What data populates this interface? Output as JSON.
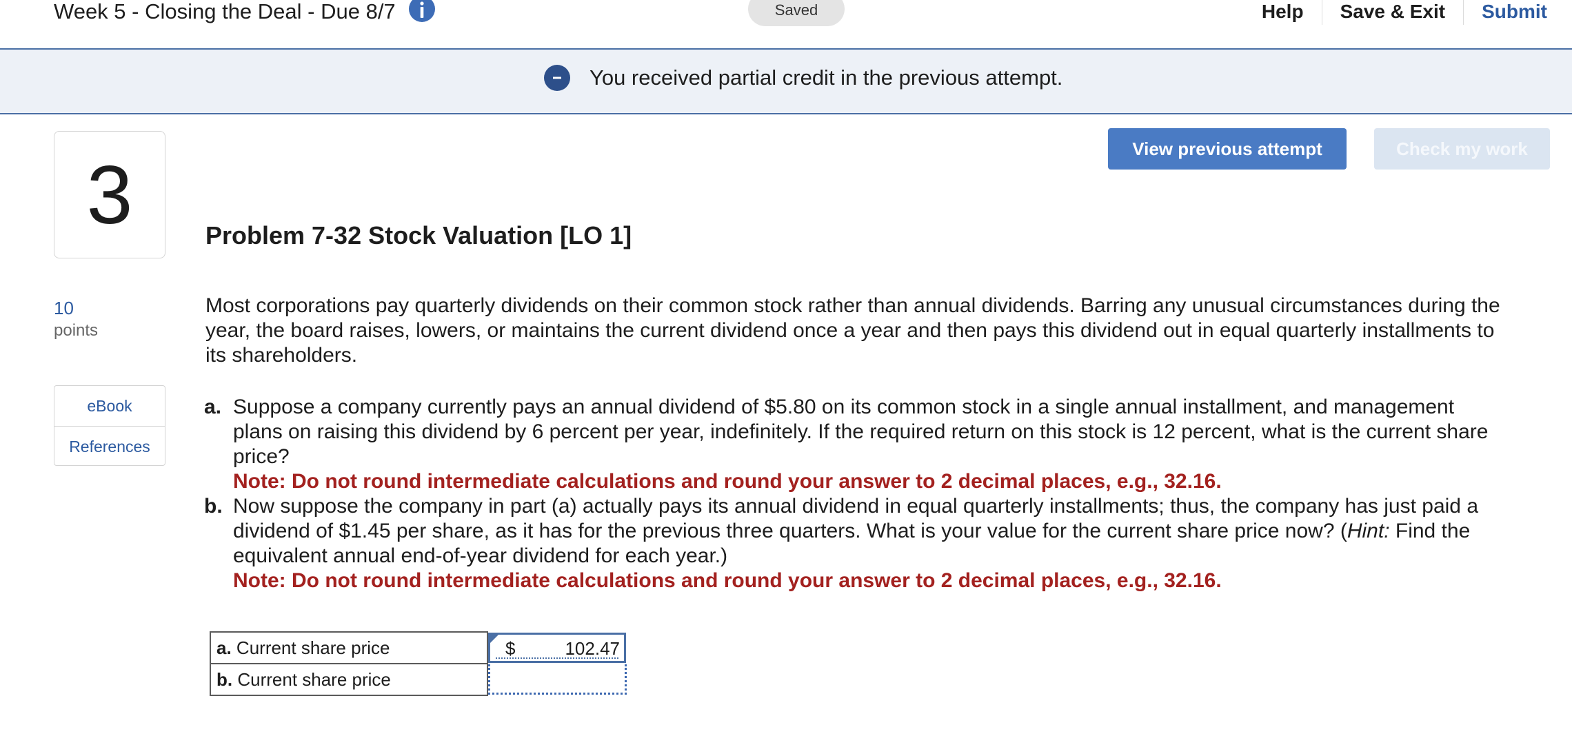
{
  "header": {
    "assignment_title": "Week 5 - Closing the Deal - Due 8/7",
    "saved_status": "Saved",
    "nav": {
      "help": "Help",
      "save_exit": "Save & Exit",
      "submit": "Submit"
    }
  },
  "banner": {
    "message": "You received partial credit in the previous attempt."
  },
  "question": {
    "number": "3",
    "points_value": "10",
    "points_label": "points",
    "resources": {
      "ebook": "eBook",
      "references": "References"
    }
  },
  "buttons": {
    "view_previous": "View previous attempt",
    "check_work": "Check my work"
  },
  "problem": {
    "title": "Problem 7-32 Stock Valuation [LO 1]",
    "intro": "Most corporations pay quarterly dividends on their common stock rather than annual dividends. Barring any unusual circumstances during the year, the board raises, lowers, or maintains the current dividend once a year and then pays this dividend out in equal quarterly installments to its shareholders.",
    "parts": [
      {
        "letter": "a.",
        "text": "Suppose a company currently pays an annual dividend of $5.80 on its common stock in a single annual installment, and management plans on raising this dividend by 6 percent per year, indefinitely. If the required return on this stock is 12 percent, what is the current share price?",
        "note": "Note: Do not round intermediate calculations and round your answer to 2 decimal places, e.g., 32.16."
      },
      {
        "letter": "b.",
        "text_before": "Now suppose the company in part (a) actually pays its annual dividend in equal quarterly installments; thus, the company has just paid a dividend of $1.45 per share, as it has for the previous three quarters. What is your value for the current share price now? (",
        "hint_word": "Hint:",
        "text_after": " Find the equivalent annual end-of-year dividend for each year.)",
        "note": "Note: Do not round intermediate calculations and round your answer to 2 decimal places, e.g., 32.16."
      }
    ]
  },
  "answers": {
    "rows": [
      {
        "letter": "a.",
        "label": "Current share price",
        "currency": "$",
        "value": "102.47"
      },
      {
        "letter": "b.",
        "label": "Current share price",
        "currency": "",
        "value": ""
      }
    ]
  },
  "colors": {
    "accent": "#4a7bc4",
    "nav_link": "#2c5aa0",
    "note_red": "#a3211f",
    "banner_bg": "#edf1f7"
  }
}
